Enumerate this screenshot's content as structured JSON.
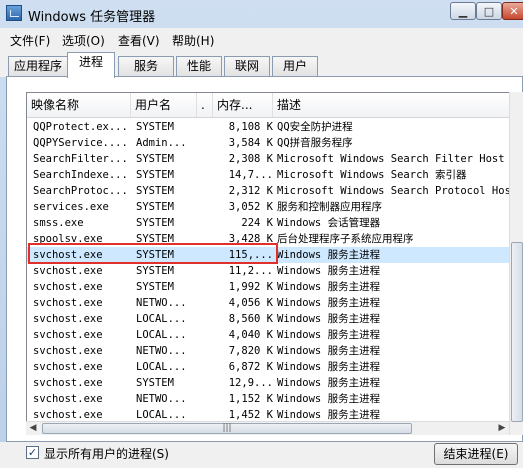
{
  "window": {
    "title": "Windows 任务管理器"
  },
  "menu": [
    {
      "label": "文件(F)"
    },
    {
      "label": "选项(O)"
    },
    {
      "label": "查看(V)"
    },
    {
      "label": "帮助(H)"
    }
  ],
  "tabs": [
    {
      "label": "应用程序",
      "active": false
    },
    {
      "label": "进程",
      "active": true
    },
    {
      "label": "服务",
      "active": false
    },
    {
      "label": "性能",
      "active": false
    },
    {
      "label": "联网",
      "active": false
    },
    {
      "label": "用户",
      "active": false
    }
  ],
  "columns": {
    "name": "映像名称",
    "user": "用户名",
    "sort": ".",
    "mem": "内存...",
    "desc": "描述"
  },
  "processes": [
    {
      "name": "QQProtect.ex...",
      "user": "SYSTEM",
      "mem": "8,108 K",
      "desc": "QQ安全防护进程"
    },
    {
      "name": "QQPYService....",
      "user": "Admin...",
      "mem": "3,584 K",
      "desc": "QQ拼音服务程序"
    },
    {
      "name": "SearchFilter...",
      "user": "SYSTEM",
      "mem": "2,308 K",
      "desc": "Microsoft Windows Search Filter Host"
    },
    {
      "name": "SearchIndexe...",
      "user": "SYSTEM",
      "mem": "14,7...",
      "desc": "Microsoft Windows Search 索引器"
    },
    {
      "name": "SearchProtoc...",
      "user": "SYSTEM",
      "mem": "2,312 K",
      "desc": "Microsoft Windows Search Protocol Host"
    },
    {
      "name": "services.exe",
      "user": "SYSTEM",
      "mem": "3,052 K",
      "desc": "服务和控制器应用程序"
    },
    {
      "name": "smss.exe",
      "user": "SYSTEM",
      "mem": "224 K",
      "desc": "Windows 会话管理器"
    },
    {
      "name": "spoolsv.exe",
      "user": "SYSTEM",
      "mem": "3,428 K",
      "desc": "后台处理程序子系统应用程序"
    },
    {
      "name": "svchost.exe",
      "user": "SYSTEM",
      "mem": "115,...",
      "desc": "Windows 服务主进程",
      "selected": true
    },
    {
      "name": "svchost.exe",
      "user": "SYSTEM",
      "mem": "11,2...",
      "desc": "Windows 服务主进程"
    },
    {
      "name": "svchost.exe",
      "user": "SYSTEM",
      "mem": "1,992 K",
      "desc": "Windows 服务主进程"
    },
    {
      "name": "svchost.exe",
      "user": "NETWO...",
      "mem": "4,056 K",
      "desc": "Windows 服务主进程"
    },
    {
      "name": "svchost.exe",
      "user": "LOCAL...",
      "mem": "8,560 K",
      "desc": "Windows 服务主进程"
    },
    {
      "name": "svchost.exe",
      "user": "LOCAL...",
      "mem": "4,040 K",
      "desc": "Windows 服务主进程"
    },
    {
      "name": "svchost.exe",
      "user": "NETWO...",
      "mem": "7,820 K",
      "desc": "Windows 服务主进程"
    },
    {
      "name": "svchost.exe",
      "user": "LOCAL...",
      "mem": "6,872 K",
      "desc": "Windows 服务主进程"
    },
    {
      "name": "svchost.exe",
      "user": "SYSTEM",
      "mem": "12,9...",
      "desc": "Windows 服务主进程"
    },
    {
      "name": "svchost.exe",
      "user": "NETWO...",
      "mem": "1,152 K",
      "desc": "Windows 服务主进程"
    },
    {
      "name": "svchost.exe",
      "user": "LOCAL...",
      "mem": "1,452 K",
      "desc": "Windows 服务主进程"
    }
  ],
  "bottom": {
    "show_all_label": "显示所有用户的进程(S)",
    "show_all_checked": true,
    "end_process_label": "结束进程(E)"
  },
  "scroll": {
    "hthumb_grip": "|||"
  },
  "colors": {
    "highlight": "#e1302b",
    "selection": "#cde8ff"
  }
}
